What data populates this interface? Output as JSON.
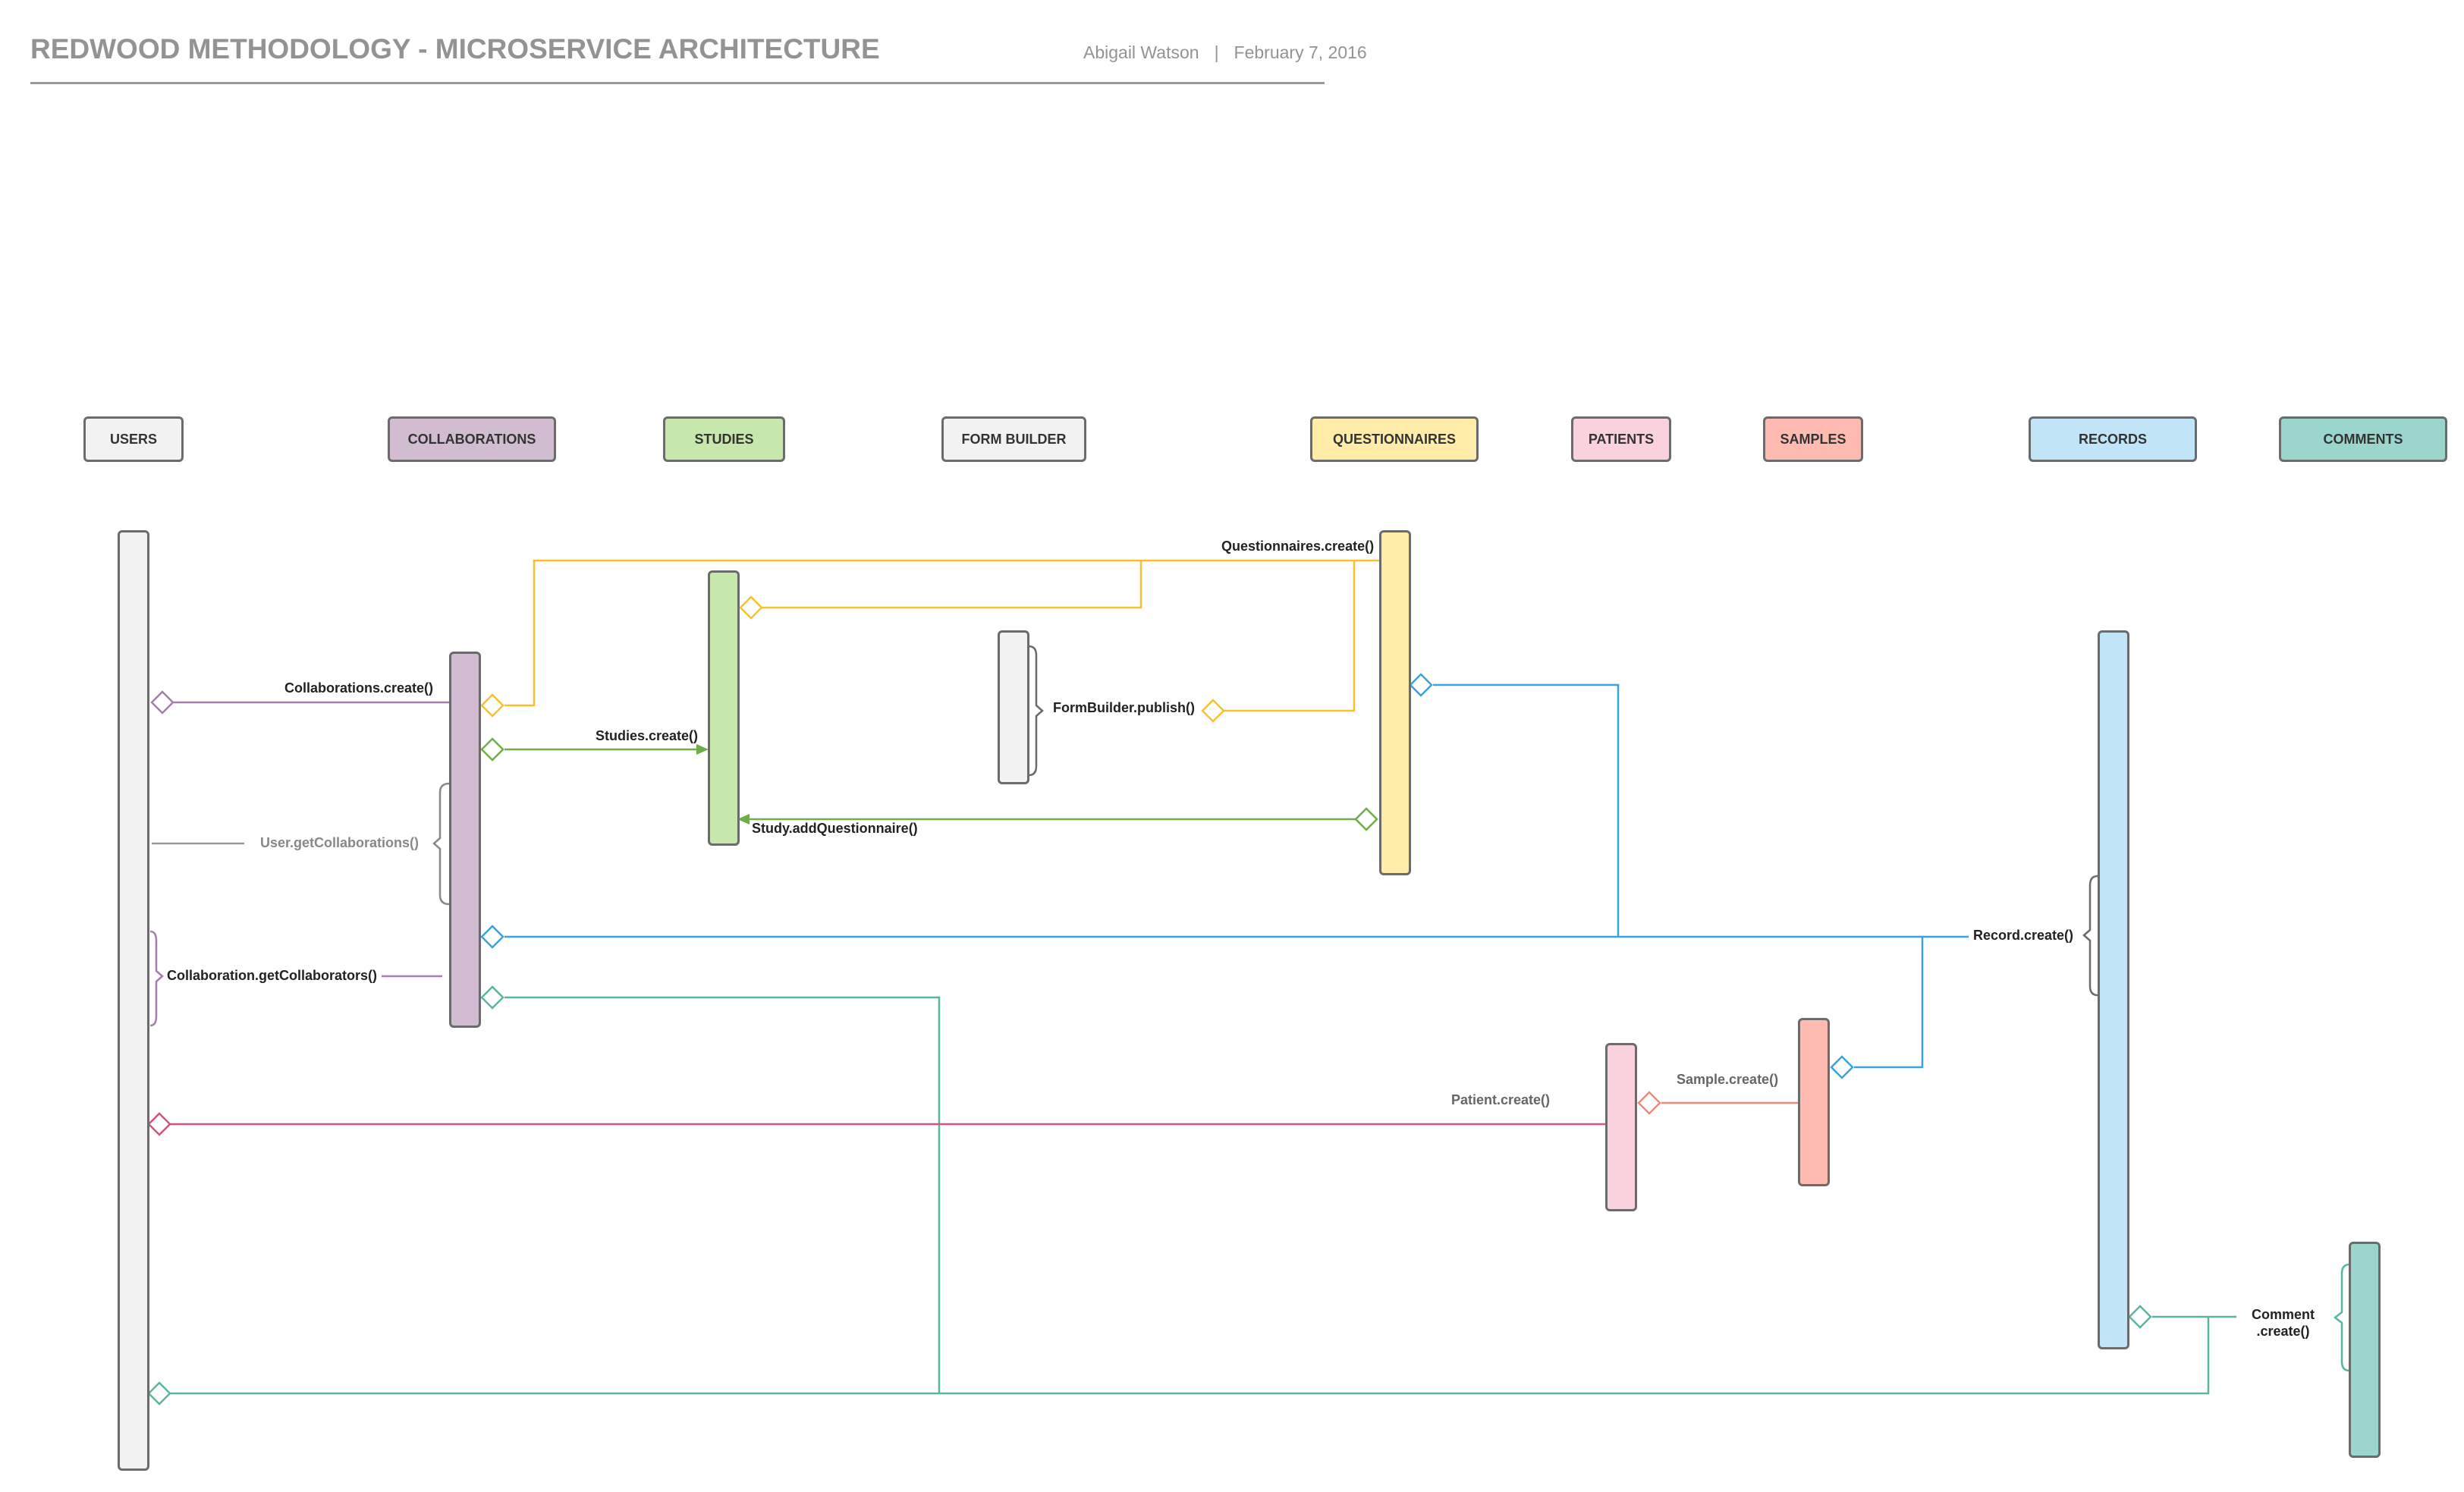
{
  "header": {
    "title": "REDWOOD METHODOLOGY - MICROSERVICE ARCHITECTURE",
    "author": "Abigail Watson",
    "separator": "|",
    "date": "February 7, 2016"
  },
  "colors": {
    "users": "#f2f2f2",
    "collaborations": "#d1bcd2",
    "studies": "#c7e8ac",
    "form_builder": "#f2f2f2",
    "questionnaires": "#ffeca9",
    "patients": "#f9d2de",
    "samples": "#ffbbb1",
    "records": "#c1e4f7",
    "comments": "#9ad6cc",
    "line_purple": "#a57fac",
    "line_yellow": "#f7c02f",
    "line_green": "#6fad46",
    "line_blue": "#3aa3d9",
    "line_teal": "#5ab5a0",
    "line_pink": "#d6527c",
    "line_salmon": "#f08a78",
    "line_grey": "#999999"
  },
  "services": [
    {
      "id": "users",
      "label": "USERS"
    },
    {
      "id": "collaborations",
      "label": "COLLABORATIONS"
    },
    {
      "id": "studies",
      "label": "STUDIES"
    },
    {
      "id": "form_builder",
      "label": "FORM BUILDER"
    },
    {
      "id": "questionnaires",
      "label": "QUESTIONNAIRES"
    },
    {
      "id": "patients",
      "label": "PATIENTS"
    },
    {
      "id": "samples",
      "label": "SAMPLES"
    },
    {
      "id": "records",
      "label": "RECORDS"
    },
    {
      "id": "comments",
      "label": "COMMENTS"
    }
  ],
  "messages": {
    "questionnaires_create": "Questionnaires.create()",
    "collaborations_create": "Collaborations.create()",
    "studies_create": "Studies.create()",
    "formbuilder_publish": "FormBuilder.publish()",
    "study_add_questionnaire": "Study.addQuestionnaire()",
    "user_get_collaborations": "User.getCollaborations()",
    "collaboration_get_collaborators": "Collaboration.getCollaborators()",
    "record_create": "Record.create()",
    "sample_create": "Sample.create()",
    "patient_create": "Patient.create()",
    "comment_create_line1": "Comment",
    "comment_create_line2": ".create()"
  }
}
